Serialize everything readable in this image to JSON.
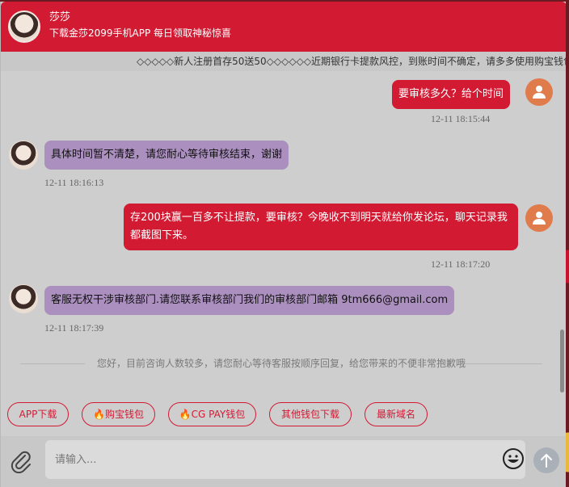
{
  "header": {
    "name": "莎莎",
    "subtitle": "下载金莎2099手机APP 每日领取神秘惊喜"
  },
  "marquee": {
    "text": "◇◇◇◇◇新人注册首存50送50◇◇◇◇◇◇近期银行卡提款风控，到账时间不确定，请多多使用购宝钱包"
  },
  "messages": [
    {
      "from": "user",
      "text": "要审核多久？给个时间",
      "time": "12-11 18:15:44"
    },
    {
      "from": "agent",
      "text": "具体时间暂不清楚，请您耐心等待审核结束，谢谢",
      "time": "12-11 18:16:13"
    },
    {
      "from": "user",
      "text": "存200块赢一百多不让提款，要审核？今晚收不到明天就给你发论坛，聊天记录我都截图下来。",
      "time": "12-11 18:17:20"
    },
    {
      "from": "agent",
      "text": "客服无权干涉审核部门.请您联系审核部门我们的审核部门邮箱 9tm666@gmail.com",
      "time": "12-11 18:17:39"
    }
  ],
  "notice": "您好，目前咨询人数较多，请您耐心等待客服按顺序回复，给您带来的不便非常抱歉哦",
  "quick_buttons": [
    {
      "label": "APP下载"
    },
    {
      "label": "🔥购宝钱包"
    },
    {
      "label": "🔥CG PAY钱包"
    },
    {
      "label": "其他钱包下载"
    },
    {
      "label": "最新域名"
    }
  ],
  "input": {
    "placeholder": "请输入..."
  },
  "colors": {
    "accent": "#d31a33",
    "agent_bubble": "#ab8fbf",
    "user_avatar": "#e07b4b"
  },
  "icons": {
    "attach": "paperclip-icon",
    "emoji": "smiley-icon",
    "send": "arrow-up-icon",
    "user": "person-icon"
  }
}
